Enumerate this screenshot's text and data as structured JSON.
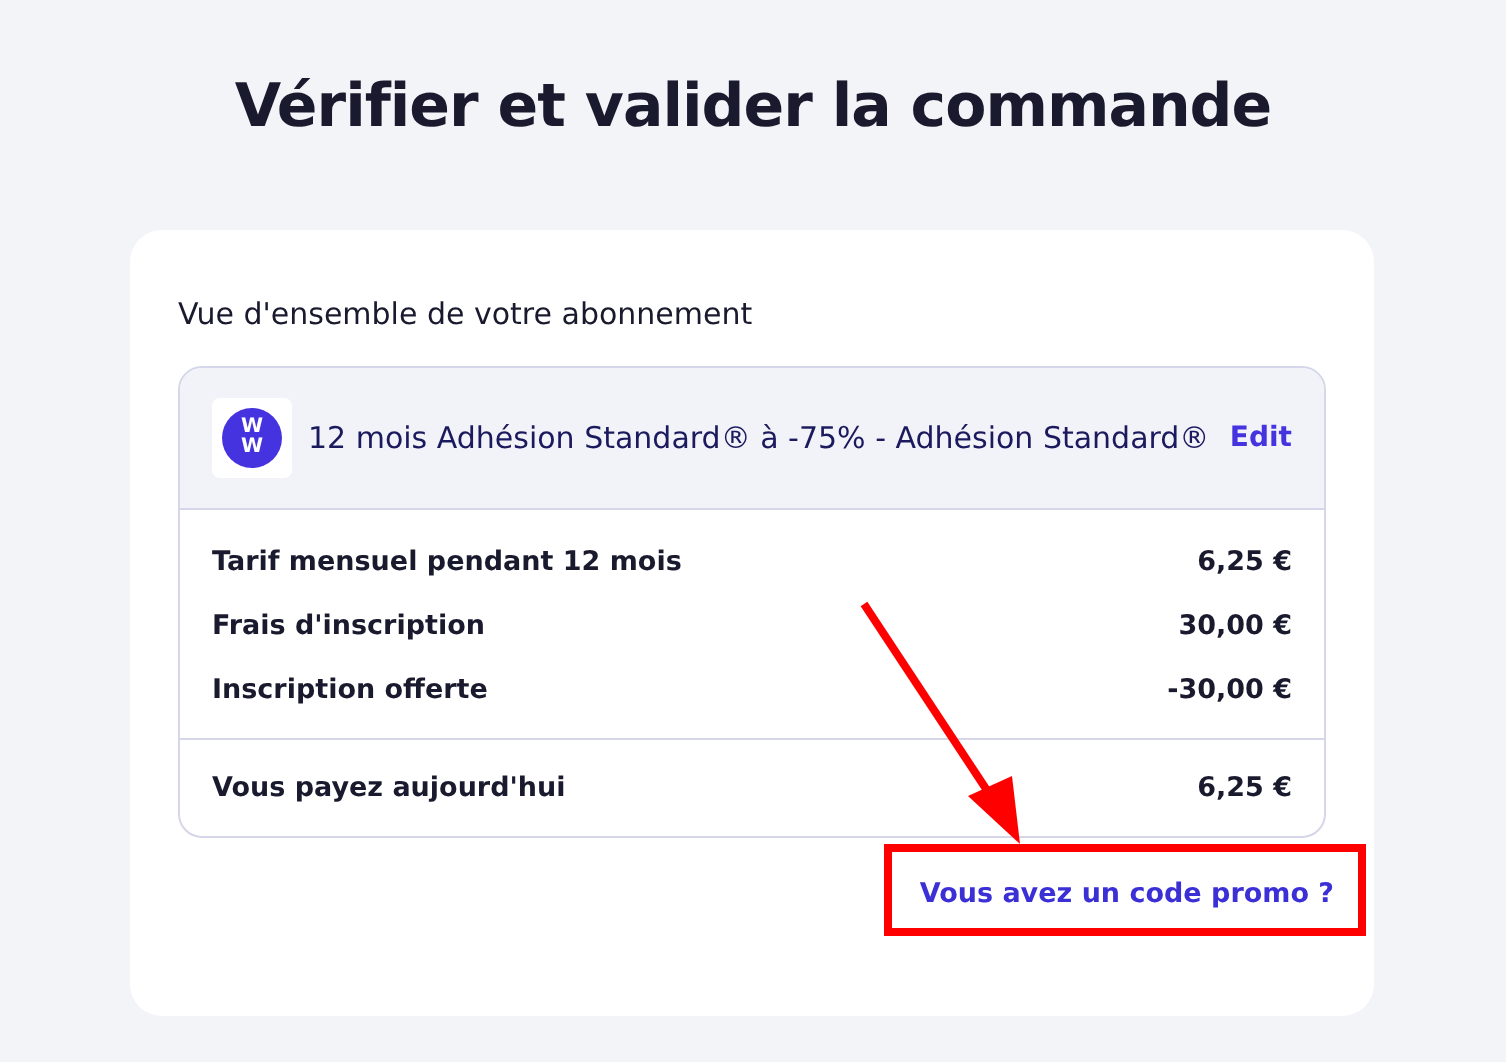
{
  "title": "Vérifier et valider la commande",
  "card": {
    "heading": "Vue d'ensemble de votre abonnement",
    "plan": {
      "logo": [
        "W",
        "W"
      ],
      "name": "12 mois Adhésion Standard® à -75% - Adhésion Standard®",
      "edit": "Edit"
    },
    "lines": [
      {
        "label": "Tarif mensuel pendant 12 mois",
        "amount": "6,25 €"
      },
      {
        "label": "Frais d'inscription",
        "amount": "30,00 €"
      },
      {
        "label": "Inscription offerte",
        "amount": "-30,00 €"
      }
    ],
    "total": {
      "label": "Vous payez aujourd'hui",
      "amount": "6,25 €"
    },
    "promo_link": "Vous avez un code promo ?"
  }
}
